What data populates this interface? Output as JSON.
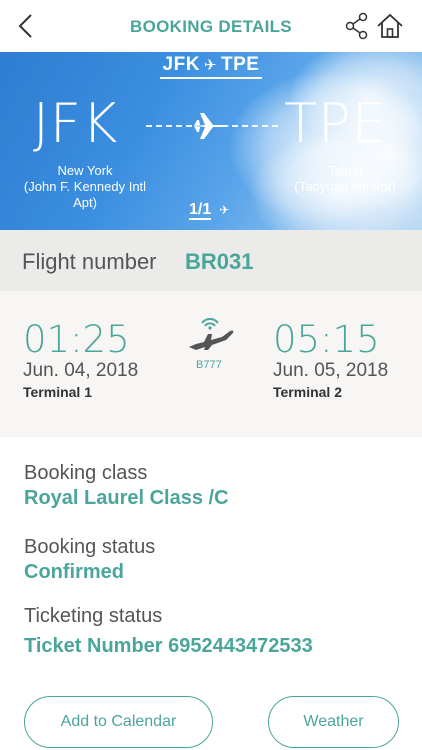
{
  "header": {
    "title": "BOOKING DETAILS",
    "icons": {
      "back": "chevron-left-icon",
      "share": "share-icon",
      "home": "home-icon"
    }
  },
  "route": {
    "summary_from": "JFK",
    "summary_to": "TPE",
    "from_code": "JFK",
    "to_code": "TPE",
    "from_city": "New York",
    "from_airport": "(John F. Kennedy Intl Apt)",
    "to_city": "Taipei",
    "to_airport": "(Taoyuan Intl Apt)",
    "leg_counter": "1/1"
  },
  "flight": {
    "label": "Flight number",
    "number": "BR031"
  },
  "departure": {
    "time": "01:25",
    "date": "Jun. 04, 2018",
    "terminal": "Terminal 1"
  },
  "arrival": {
    "time": "05:15",
    "date": "Jun. 05, 2018",
    "terminal": "Terminal 2"
  },
  "aircraft": {
    "type": "B777",
    "icon": "wifi-airplane-icon"
  },
  "booking": {
    "class_label": "Booking class",
    "class_value": "Royal Laurel Class /C",
    "status_label": "Booking status",
    "status_value": "Confirmed",
    "ticketing_label": "Ticketing status",
    "ticketing_value": "Ticket Number 6952443472533"
  },
  "actions": {
    "calendar": "Add to Calendar",
    "weather": "Weather"
  },
  "colors": {
    "accent": "#4aa69a",
    "banner": "#3b8ee0",
    "flightbar_bg": "#ebebe9"
  }
}
